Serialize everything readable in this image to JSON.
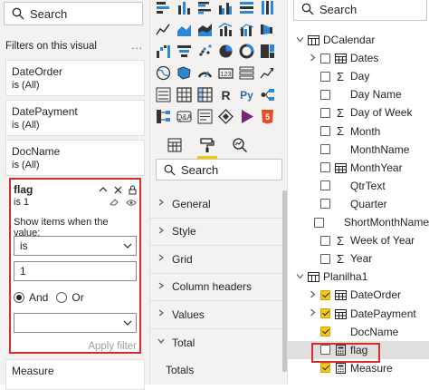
{
  "colors": {
    "accent": "#f2c811",
    "highlight": "#d32f2f"
  },
  "filters": {
    "search_placeholder": "Search",
    "heading": "Filters on this visual",
    "more": "...",
    "cards": [
      {
        "title": "DateOrder",
        "state": "is (All)"
      },
      {
        "title": "DatePayment",
        "state": "is (All)"
      },
      {
        "title": "DocName",
        "state": "is (All)"
      }
    ],
    "flag": {
      "title": "flag",
      "state": "is 1",
      "show_label": "Show items when the value:",
      "operator": "is",
      "value": "1",
      "and_label": "And",
      "or_label": "Or",
      "apply": "Apply filter"
    },
    "measure": {
      "title": "Measure"
    }
  },
  "viz": {
    "icons": [
      "stacked-bar-icon",
      "stacked-column-icon",
      "clustered-bar-icon",
      "clustered-column-icon",
      "100-bar-icon",
      "100-column-icon",
      "line-icon",
      "area-icon",
      "stacked-area-icon",
      "line-column-icon",
      "line-clustered-icon",
      "ribbon-icon",
      "waterfall-icon",
      "funnel-icon",
      "scatter-icon",
      "pie-icon",
      "donut-icon",
      "treemap-icon",
      "map-icon",
      "filled-map-icon",
      "gauge-icon",
      "card-icon",
      "multi-row-card-icon",
      "kpi-icon",
      "slicer-icon",
      "table-icon",
      "matrix-icon",
      "r-visual-icon",
      "python-visual-icon",
      "key-influencers-icon",
      "decomposition-tree-icon",
      "qa-icon",
      "smart-narrative-icon",
      "paginated-icon",
      "power-apps-icon",
      "html-icon"
    ],
    "tabs": [
      "fields-tab",
      "format-tab",
      "analytics-tab"
    ],
    "search_placeholder": "Search",
    "sections": [
      "General",
      "Style",
      "Grid",
      "Column headers",
      "Values",
      "Total",
      "Totals"
    ]
  },
  "fields": {
    "search_placeholder": "Search",
    "tables": [
      {
        "name": "DCalendar",
        "items": [
          "Dates",
          "Day",
          "Day Name",
          "Day of Week",
          "Month",
          "MonthName",
          "MonthYear",
          "QtrText",
          "Quarter",
          "ShortMonthName",
          "Week of Year",
          "Year"
        ]
      },
      {
        "name": "Planilha1",
        "items": [
          "DateOrder",
          "DatePayment",
          "DocName",
          "flag",
          "Measure"
        ]
      }
    ]
  }
}
